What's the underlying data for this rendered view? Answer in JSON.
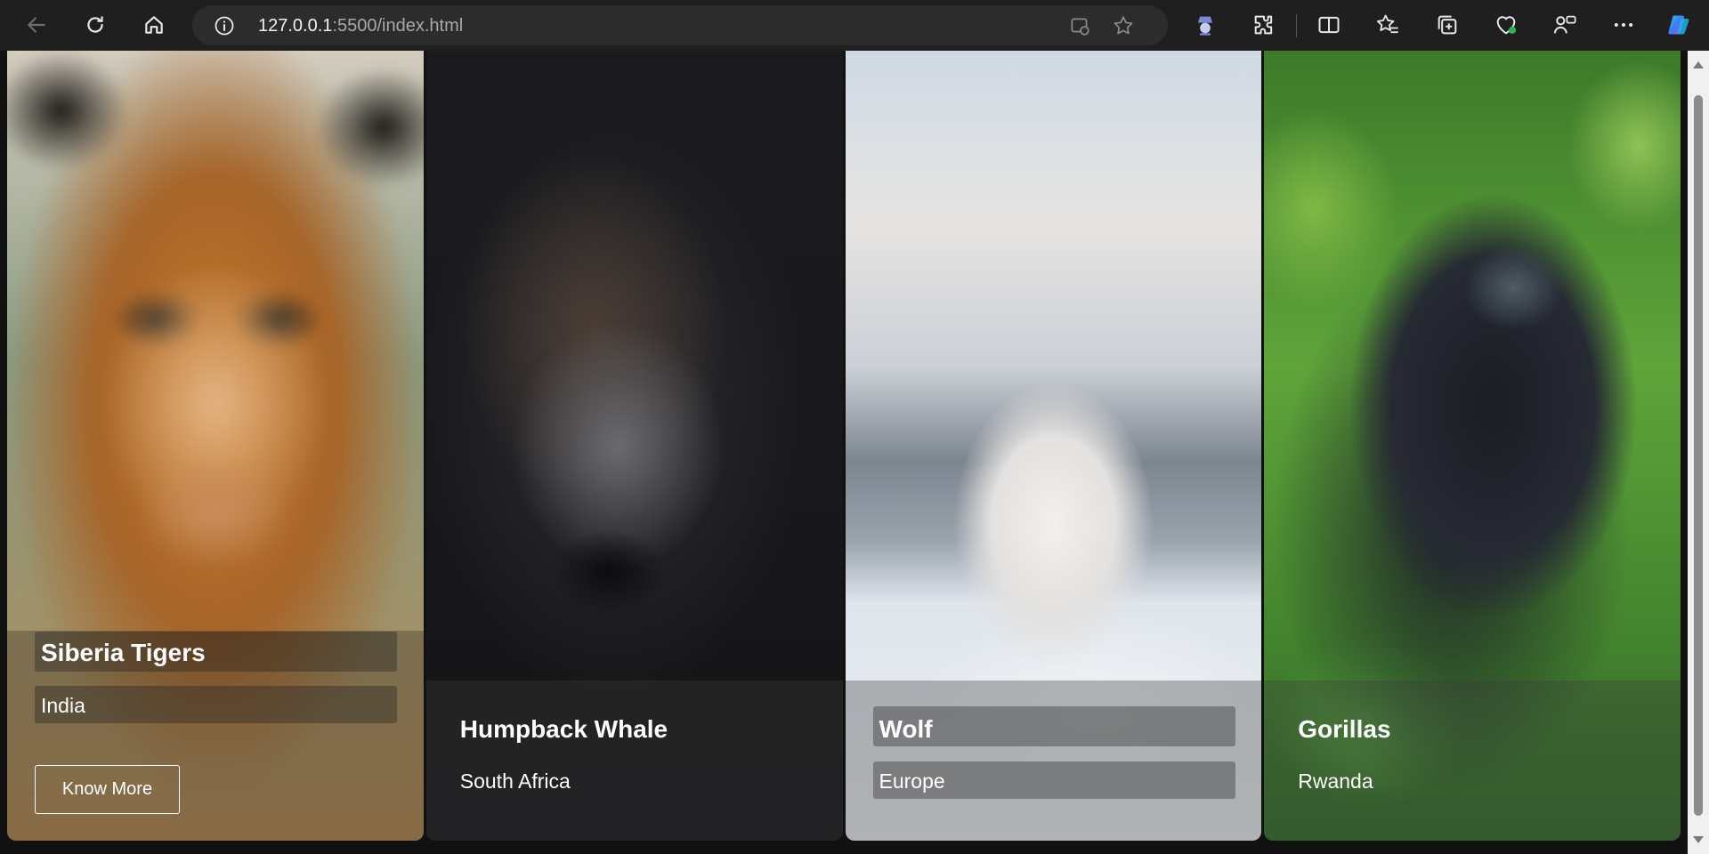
{
  "browser": {
    "url_host": "127.0.0.1",
    "url_path": ":5500/index.html"
  },
  "cards": [
    {
      "title": "Siberia Tigers",
      "location": "India",
      "button_label": "Know More"
    },
    {
      "title": "Humpback Whale",
      "location": "South Africa"
    },
    {
      "title": "Wolf",
      "location": "Europe"
    },
    {
      "title": "Gorillas",
      "location": "Rwanda"
    }
  ]
}
